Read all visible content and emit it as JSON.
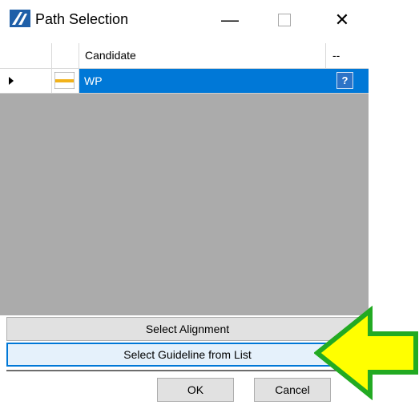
{
  "window": {
    "title": "Path Selection",
    "minimize_glyph": "—",
    "close_glyph": "✕",
    "app_icon": "road-logo-icon"
  },
  "grid": {
    "columns": [
      "",
      "",
      "Candidate",
      "--"
    ],
    "rows": [
      {
        "candidate": "WP",
        "selected": true,
        "icon": "line-style-icon",
        "help_label": "?"
      }
    ]
  },
  "buttons": {
    "select_alignment": "Select Alignment",
    "select_guideline": "Select Guideline from List",
    "ok": "OK",
    "cancel": "Cancel"
  },
  "colors": {
    "selection": "#0078d7",
    "grid_background": "#ababab",
    "arrow_fill": "#ffff00",
    "arrow_border": "#22aa22"
  }
}
